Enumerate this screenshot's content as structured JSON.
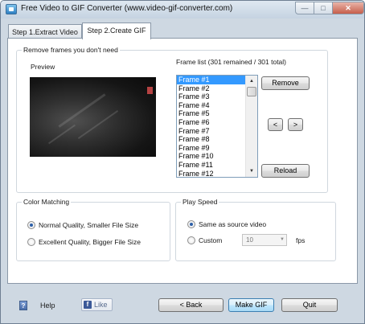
{
  "window": {
    "title": "Free Video to GIF Converter (www.video-gif-converter.com)",
    "min_glyph": "—",
    "max_glyph": "□",
    "close_glyph": "✕"
  },
  "tabs": [
    {
      "label": "Step 1.Extract Video",
      "active": false
    },
    {
      "label": "Step 2.Create GIF",
      "active": true
    }
  ],
  "remove_group": {
    "title": "Remove frames you don't need",
    "preview_label": "Preview",
    "framelist_label": "Frame list (301 remained / 301 total)",
    "frames": [
      "Frame #1",
      "Frame #2",
      "Frame #3",
      "Frame #4",
      "Frame #5",
      "Frame #6",
      "Frame #7",
      "Frame #8",
      "Frame #9",
      "Frame #10",
      "Frame #11",
      "Frame #12"
    ],
    "selected_frame_index": 0,
    "remove_label": "Remove",
    "prev_label": "<",
    "next_label": ">",
    "reload_label": "Reload"
  },
  "color_group": {
    "title": "Color Matching",
    "options": [
      {
        "label": "Normal Quality, Smaller File Size",
        "checked": true
      },
      {
        "label": "Excellent Quality, Bigger File Size",
        "checked": false
      }
    ]
  },
  "speed_group": {
    "title": "Play Speed",
    "same_label": "Same as source video",
    "custom_label": "Custom",
    "fps_value": "10",
    "fps_unit": "fps",
    "selected": "same"
  },
  "bottom": {
    "help_label": "Help",
    "like_label": "Like",
    "back_label": "< Back",
    "make_label": "Make GIF",
    "quit_label": "Quit"
  },
  "colors": {
    "selection": "#3399ff",
    "window_frame": "#ced8e2",
    "facebook": "#3b5998"
  }
}
